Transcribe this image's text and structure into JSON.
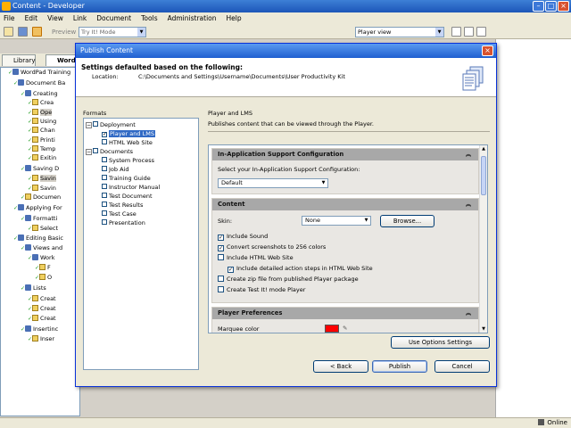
{
  "app": {
    "title": "Content - Developer",
    "menu": [
      "File",
      "Edit",
      "View",
      "Link",
      "Document",
      "Tools",
      "Administration",
      "Help"
    ],
    "toolbar": {
      "preview_label": "Preview",
      "mode_value": "Try It! Mode",
      "view_value": "Player view"
    },
    "tabs": [
      "Library",
      "Word"
    ]
  },
  "tree": [
    {
      "label": "WordPad Training",
      "icon": "book"
    },
    {
      "label": "Document Ba",
      "icon": "book"
    },
    {
      "label": "Creating",
      "icon": "book"
    },
    {
      "label": "Crea",
      "icon": "page"
    },
    {
      "label": "Ope",
      "icon": "page",
      "selected": true
    },
    {
      "label": "Using",
      "icon": "page"
    },
    {
      "label": "Chan",
      "icon": "page"
    },
    {
      "label": "Printi",
      "icon": "page"
    },
    {
      "label": "Temp",
      "icon": "page"
    },
    {
      "label": "Exitin",
      "icon": "page"
    },
    {
      "label": "Saving D",
      "icon": "book"
    },
    {
      "label": "Savin",
      "icon": "page",
      "selected": true
    },
    {
      "label": "Savin",
      "icon": "page"
    },
    {
      "label": "Documen",
      "icon": "page"
    },
    {
      "label": "Applying For",
      "icon": "book"
    },
    {
      "label": "Formatti",
      "icon": "book"
    },
    {
      "label": "Select",
      "icon": "page"
    },
    {
      "label": "Editing Basic",
      "icon": "book"
    },
    {
      "label": "Views and",
      "icon": "book"
    },
    {
      "label": "Work",
      "icon": "book"
    },
    {
      "label": "F",
      "icon": "page"
    },
    {
      "label": "O",
      "icon": "page"
    },
    {
      "label": "Lists",
      "icon": "book"
    },
    {
      "label": "Creat",
      "icon": "page"
    },
    {
      "label": "Creat",
      "icon": "page"
    },
    {
      "label": "Creat",
      "icon": "page"
    },
    {
      "label": "Insertinc",
      "icon": "book"
    },
    {
      "label": "Inser",
      "icon": "page"
    }
  ],
  "status": {
    "online": "Online"
  },
  "dialog": {
    "title": "Publish Content",
    "heading": "Settings defaulted based on the following:",
    "location_label": "Location:",
    "location_value": "C:\\Documents and Settings\\Username\\Documents\\User Productivity Kit",
    "formats_label": "Formats",
    "formats": [
      {
        "label": "Deployment",
        "kind": "group"
      },
      {
        "label": "Player and LMS",
        "kind": "item",
        "checked": true,
        "selected": true
      },
      {
        "label": "HTML Web Site",
        "kind": "item",
        "checked": false
      },
      {
        "label": "Documents",
        "kind": "group"
      },
      {
        "label": "System Process",
        "kind": "item",
        "checked": false
      },
      {
        "label": "Job Aid",
        "kind": "item",
        "checked": false
      },
      {
        "label": "Training Guide",
        "kind": "item",
        "checked": false
      },
      {
        "label": "Instructor Manual",
        "kind": "item",
        "checked": false
      },
      {
        "label": "Test Document",
        "kind": "item",
        "checked": false
      },
      {
        "label": "Test Results",
        "kind": "item",
        "checked": false
      },
      {
        "label": "Test Case",
        "kind": "item",
        "checked": false
      },
      {
        "label": "Presentation",
        "kind": "item",
        "checked": false
      }
    ],
    "panel_title": "Player and LMS",
    "panel_desc": "Publishes content that can be viewed through the Player.",
    "support_section": {
      "title": "In-Application Support Configuration",
      "select_label": "Select your In-Application Support Configuration:",
      "select_value": "Default"
    },
    "content_section": {
      "title": "Content",
      "skin_label": "Skin:",
      "skin_value": "None",
      "browse_label": "Browse...",
      "options": [
        {
          "label": "Include Sound",
          "checked": true
        },
        {
          "label": "Convert screenshots to 256 colors",
          "checked": true
        },
        {
          "label": "Include HTML Web Site",
          "checked": false
        },
        {
          "label": "Include detailed action steps in HTML Web Site",
          "checked": true
        },
        {
          "label": "Create zip file from published Player package",
          "checked": false
        },
        {
          "label": "Create Test It! mode Player",
          "checked": false
        }
      ]
    },
    "prefs_section": {
      "title": "Player Preferences",
      "marquee_label": "Marquee color",
      "marquee_color": "#ff0000"
    },
    "use_options_label": "Use Options Settings",
    "back_label": "< Back",
    "publish_label": "Publish",
    "cancel_label": "Cancel"
  }
}
